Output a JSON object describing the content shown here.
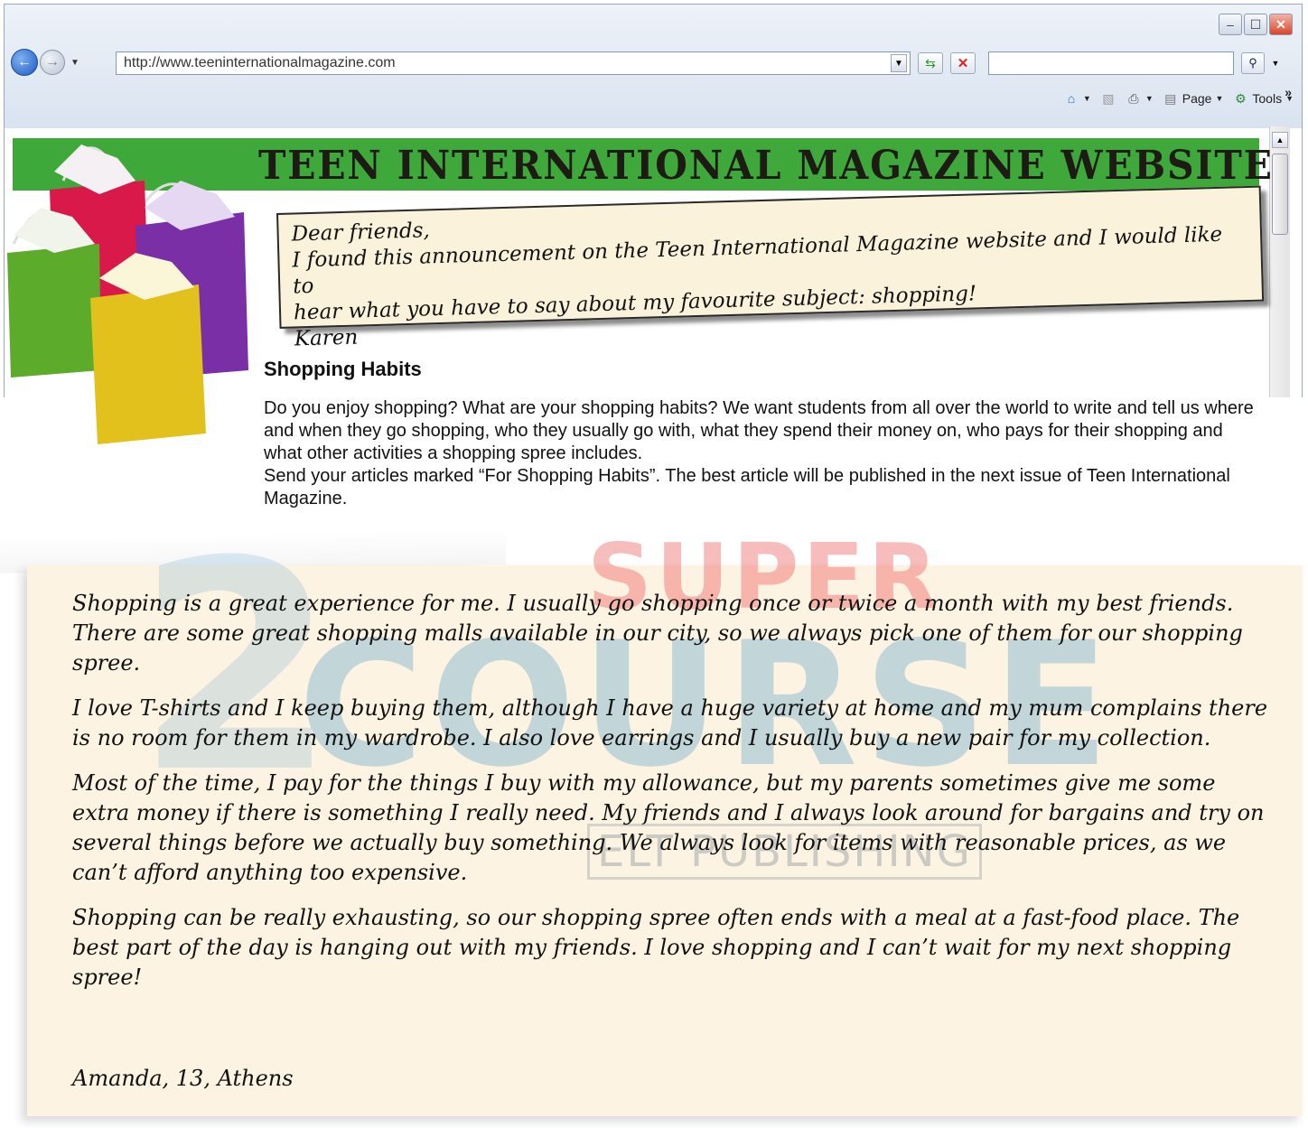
{
  "browser": {
    "address": "http://www.teeninternationalmagazine.com",
    "search_value": "",
    "command_bar": {
      "page_label": "Page",
      "tools_label": "Tools",
      "overflow": "»"
    },
    "icons": [
      "back-arrow-icon",
      "forward-arrow-icon",
      "refresh-icon",
      "stop-icon",
      "search-icon",
      "home-icon",
      "feeds-icon",
      "print-icon",
      "page-icon",
      "tools-gear-icon",
      "minimize-icon",
      "maximize-icon",
      "close-icon"
    ]
  },
  "site": {
    "banner_title": "Teen International Magazine Website",
    "banner_color": "#3ea83a"
  },
  "note": {
    "greeting": "Dear friends,",
    "line1": "I found this announcement on the Teen International Magazine website and I would like to",
    "line2": "hear what you have to say about my favourite subject: shopping!",
    "signature": "Karen"
  },
  "announcement": {
    "title": "Shopping Habits",
    "body": "Do you enjoy shopping? What are your shopping habits? We want students from all over the world to write and tell us where and when they go shopping, who they usually go with, what they spend their money on, who pays for their shopping and what other activities a shopping spree includes.",
    "instructions": "Send your articles marked “For Shopping Habits”. The best article will be published in the next issue of Teen International Magazine."
  },
  "letter": {
    "paragraphs": [
      "Shopping is a great experience for me. I usually go shopping once or twice a month with my best friends. There are some great shopping malls available in our city, so we always pick one of them for our shopping spree.",
      "I love T-shirts and I keep buying them, although I have a huge variety at home and my mum complains there is no room for them in my wardrobe. I also love earrings and I usually buy a new pair for my collection.",
      "Most of the time, I pay for the things I buy with my allowance, but my parents sometimes give me some extra money if there is something I really need. My friends and I always look around for bargains and try on several things before we actually buy something. We always look for items with reasonable prices, as we can’t afford anything too expensive.",
      "Shopping can be really exhausting, so our shopping spree often ends with a meal at a fast-food place. The best part of the day is hanging out with my friends. I love shopping and I can’t wait for my next shopping spree!"
    ],
    "signoff": "Amanda, 13, Athens"
  },
  "watermark": {
    "line1": "SUPER",
    "line2": "COURSE",
    "line3": "ELT PUBLISHING"
  }
}
